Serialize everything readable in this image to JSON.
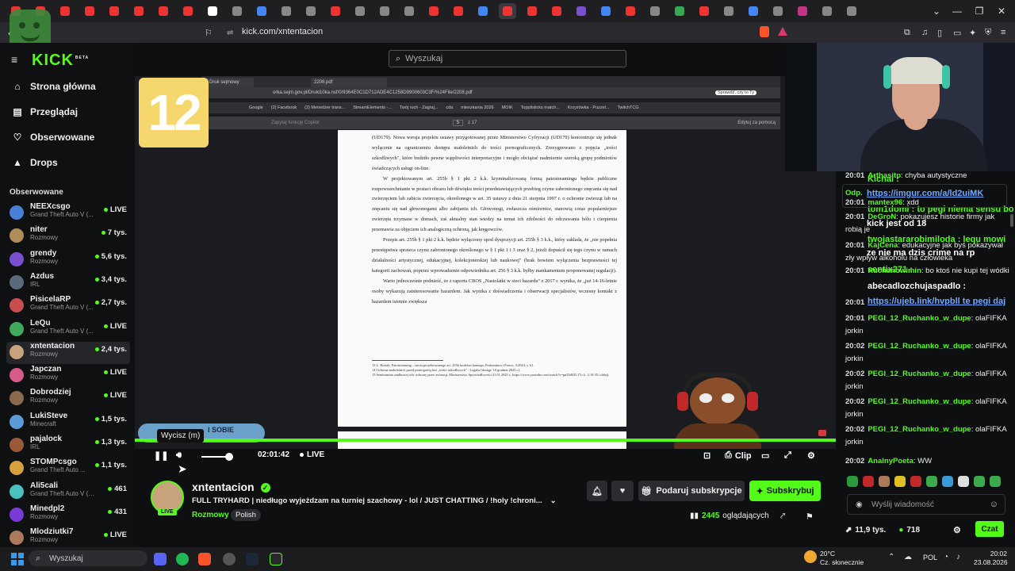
{
  "browser": {
    "url": "kick.com/xntentacion",
    "tabs": [
      "v",
      "v",
      "v",
      "v",
      "v",
      "v",
      "v",
      "v",
      "v",
      "v",
      "v",
      "v",
      "v",
      "v",
      "v",
      "v",
      "v",
      "v",
      "v",
      "v",
      "v",
      "v",
      "v",
      "v",
      "v",
      "v",
      "v",
      "v",
      "v",
      "v",
      "v",
      "v",
      "v",
      "v",
      "v"
    ]
  },
  "site": {
    "logo_text": "KICK",
    "logo_badge": "BETA",
    "search_placeholder": "Wyszukaj"
  },
  "sidebar": {
    "nav": [
      {
        "label": "Strona główna",
        "icon": "home-icon"
      },
      {
        "label": "Przeglądaj",
        "icon": "browse-icon"
      },
      {
        "label": "Obserwowane",
        "icon": "heart-icon"
      },
      {
        "label": "Drops",
        "icon": "drops-icon"
      }
    ],
    "section_title": "Obserwowane",
    "channels": [
      {
        "name": "NEEXcsgo",
        "sub": "Grand Theft Auto V (...",
        "stat": "LIVE",
        "color": "#4a7fd6"
      },
      {
        "name": "niter",
        "sub": "Rozmowy",
        "stat": "7 tys.",
        "color": "#b08c5a"
      },
      {
        "name": "grendy",
        "sub": "Rozmowy",
        "stat": "5,6 tys.",
        "color": "#7a4fcf"
      },
      {
        "name": "Azdus",
        "sub": "IRL",
        "stat": "3,4 tys.",
        "color": "#5b6a7a"
      },
      {
        "name": "PisicelaRP",
        "sub": "Grand Theft Auto V (...",
        "stat": "2,7 tys.",
        "color": "#c94d4d"
      },
      {
        "name": "LeQu",
        "sub": "Grand Theft Auto V (...",
        "stat": "LIVE",
        "color": "#3fa85a"
      },
      {
        "name": "xntentacion",
        "sub": "Rozmowy",
        "stat": "2,4 tys.",
        "color": "#c7a27a"
      },
      {
        "name": "Japczan",
        "sub": "Rozmowy",
        "stat": "LIVE",
        "color": "#d65a8a"
      },
      {
        "name": "Dobrodziej",
        "sub": "Rozmowy",
        "stat": "LIVE",
        "color": "#8a6a4a"
      },
      {
        "name": "LukiSteve",
        "sub": "Minecraft",
        "stat": "1,5 tys.",
        "color": "#5a9ad6"
      },
      {
        "name": "pajalock",
        "sub": "IRL",
        "stat": "1,3 tys.",
        "color": "#9a5a3a"
      },
      {
        "name": "STOMPcsgo",
        "sub": "Grand Theft Auto ...",
        "stat": "1,1 tys.",
        "color": "#d6a03a"
      },
      {
        "name": "Ali5cali",
        "sub": "Grand Theft Auto V (G...",
        "stat": "461",
        "color": "#4ac0c0"
      },
      {
        "name": "Minedpl2",
        "sub": "Rozmowy",
        "stat": "431",
        "color": "#7a3ad6"
      },
      {
        "name": "Mlodziutki7",
        "sub": "Rozmowy",
        "stat": "LIVE",
        "color": "#aa7a5a"
      }
    ]
  },
  "video": {
    "pdf_tabs": [
      "Druk sejmowy",
      "2208.pdf"
    ],
    "pdf_url": "orka.sejm.gov.pl/Druki10ka.nsf/0/9364E0C1D712ADE4C1258D9900603C3F/%24File/2208.pdf",
    "pdf_bookmarks": [
      "Google",
      "(2) Facebook",
      "(2) Menedżer trans...",
      "StreamElements -...",
      "Twój ruch - Zagraj...",
      "cda",
      "mieszkania 2026",
      "MOIK",
      "Topplisticks match...",
      "Krzyżówka - Puzzel...",
      "TwitchTCG"
    ],
    "pdf_toolbar": {
      "search": "Zapytaj funkcję Copilot",
      "page": "5",
      "total": "z 17",
      "edit": "Edytuj za pomocą"
    },
    "paragraphs": [
      "(UD179). Nowa wersja projektu ustawy przygotowanej przez Ministerstwo Cyfryzacji (UD179) koncentruje się jednak wyłącznie na ograniczeniu dostępu małoletnich do treści pornograficznych. Zrezygnowano z pojęcia „treści szkodliwych\", które budziło pewne wątpliwości interpretacyjne i mogło obciążać nadmiernie szeroką grupę podmiotów świadczących usługi on-line.",
      "W projektowanym art. 255b § 1 pkt 2 k.k. kryminalizowaną formą patostreamingu będzie publiczne rozpowszechnianie w postaci obrazu lub dźwięku treści przedstawiających przebieg czynu zabronionego znęcania się nad zwierzęciem lub zabicia zwierzęcia, określonego w art. 35 ustawy z dnia 21 sierpnia 1997 r. o ochronie zwierząt lub na znęcaniu się nad głowonogami albo zabijaniu ich. Głowonogi, zwłaszcza ośmiornice, stanowią coraz popularniejsze zwierzęta trzymane w domach, zaś aktualny stan wiedzy na temat ich zdolności do odczuwania bólu i cierpienia przemawia za objęciem ich analogiczną ochroną, jak kręgowców.",
      "Przepis art. 255b § 1 pkt 2 k.k. będzie wyłączony spod dyspozycji art. 255b § 3 k.k., który zakłada, że „nie popełnia przestępstwa sprawca czynu zabronionego określonego w § 1 pkt 1 i 3 oraz § 2, jeżeli dopuścił się tego czynu w ramach działalności artystycznej, edukacyjnej, kolekcjonerskiej lub naukowej\" (brak bowiem wyłączenia bezprawności tej kategorii zachowań, poprzez wprowadzenie odpowiednika art. 256 § 3 k.k. byłby mankamentem proponowanej regulacji).",
      "Warto jednocześnie podnieść, że z raportu CBOS „Nastolatki w sieci hazardu\" z 2017 r. wynika, że „już 14-16-letnie osoby wykazują zainteresowanie hazardem. Jak wynika z doświadczenia i obserwacji specjalistów, wczesny kontakt z hazardem istotnie zwiększa"
    ],
    "footnotes": [
      "13 L. Rosiak, Patostreaming – istota projektowanego art. 255b kodeksu karnego, Prokuratura i Prawo, 3/2024, s. 61.",
      "14 Ochrona małoletnich przed pornografią bez „treści szkodliwych\" - Legalis [dostęp: 10 grudnia 2025 r.].",
      "15 Seminarium zaułkowej ulic ochrony praw zwierząt, Ministerstwo Sprawiedliwości 21.01.2025 r., https://www.youtube.com/watch?v=pnUb8JJL17o (t. 2:10:35 i dalej)."
    ],
    "badge": "12",
    "tooltip": "Wycisz (m)",
    "overlay_banner": "I SOBIE",
    "time": "02:01:42",
    "live_label": "LIVE",
    "clip_label": "Clip"
  },
  "stream": {
    "streamer": "xntentacion",
    "live": "LIVE",
    "title": "FULL TRYHARD | niedługo wyjeżdzam na turniej szachowy - lol / JUST CHATTING / !holy !chroni...",
    "category": "Rozmowy",
    "tag": "Polish",
    "donate_label": "Podaruj subskrypcje",
    "subscribe_label": "Subskrybuj",
    "viewers_count": "2445",
    "viewers_label": "oglądających"
  },
  "chat": {
    "messages": [
      {
        "time": "20:01",
        "user": "Arthasitp",
        "text": "chyba autystyczne"
      },
      {
        "time": "",
        "user": "Odp.",
        "text": ""
      },
      {
        "time": "20:01",
        "user": "mantex96",
        "text": "xdd"
      },
      {
        "time": "20:01",
        "user": "DeGroN",
        "text": "pokazujesz historie firmy jak robią je"
      },
      {
        "time": "20:01",
        "user": "KajCena",
        "text": "edukacyjne jak byś pokazywał zły wpływ alkoholu na człowieka"
      },
      {
        "time": "20:01",
        "user": "Ruchanowimin",
        "text": "bo ktoś nie kupi tej wódki"
      },
      {
        "time": "20:01",
        "user": "",
        "text": ""
      },
      {
        "time": "20:01",
        "user": "PEGI_12_Ruchanko_w_dupe",
        "text": "olaFIFKA jorkin"
      },
      {
        "time": "20:02",
        "user": "PEGI_12_Ruchanko_w_dupe",
        "text": "olaFIFKA jorkin"
      },
      {
        "time": "20:02",
        "user": "PEGI_12_Ruchanko_w_dupe",
        "text": "olaFIFKA jorkin"
      },
      {
        "time": "20:02",
        "user": "PEGI_12_Ruchanko_w_dupe",
        "text": "olaFIFKA jorkin"
      },
      {
        "time": "20:02",
        "user": "PEGI_12_Ruchanko_w_dupe",
        "text": "olaFIFKA jorkin"
      },
      {
        "time": "20:02",
        "user": "AnalnyPoeta",
        "text": "WW"
      }
    ],
    "overlays": [
      "Kichal :",
      "https://imgur.com/a/ld2uiMK",
      "tom1domi : to pegi niema sensu bo",
      "kick jest od 18",
      "twojastararobimiloda : lequ mowi",
      "ze nie ma dzis crime na rp",
      "sentix271 :",
      "abecadlozchujaspadlo :",
      "https://ujeb.link/hvpbll te pegi daj"
    ],
    "input_placeholder": "Wyślij wiadomość",
    "points": "11,9 tys.",
    "points2": "718",
    "chat_button": "Czat"
  },
  "taskbar": {
    "search": "Wyszukaj",
    "weather_temp": "20°C",
    "weather_desc": "Cz. słonecznie",
    "lang": "POL",
    "time": "20:02",
    "date": "23.08.2026"
  }
}
